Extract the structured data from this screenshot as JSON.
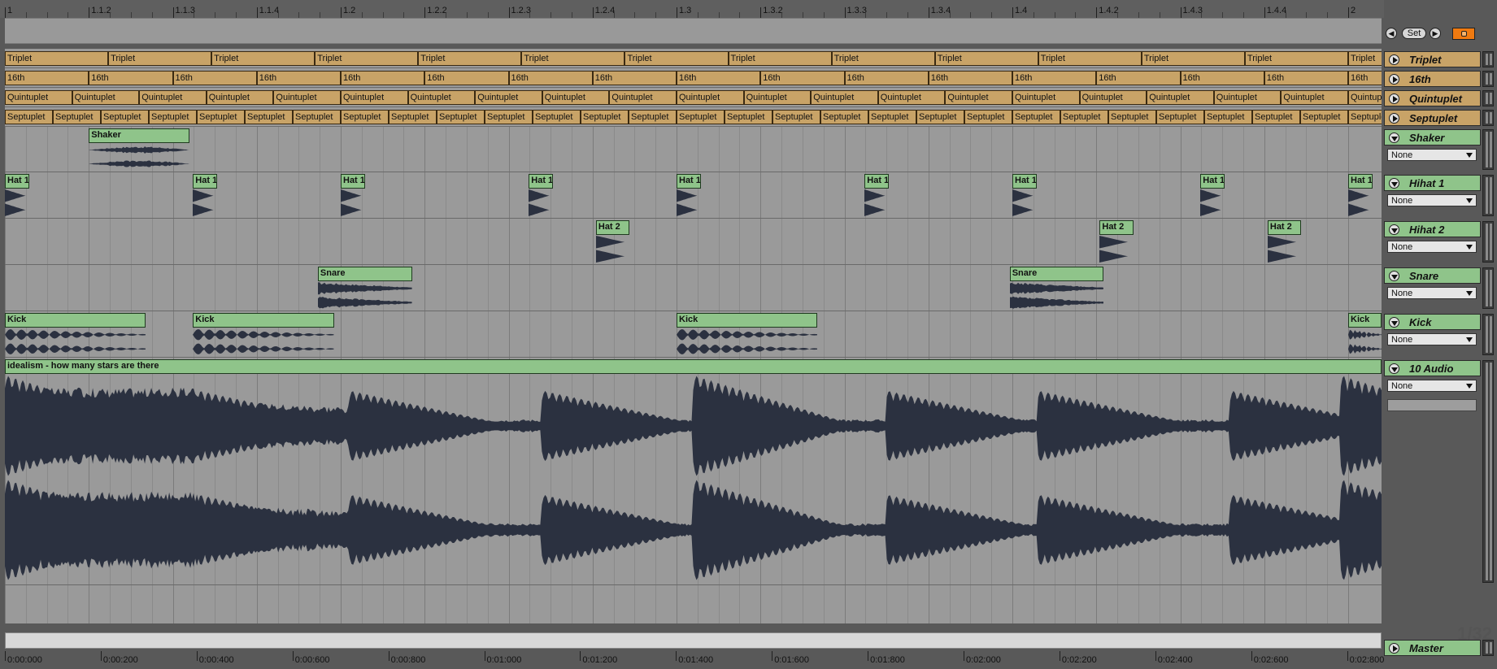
{
  "ruler": {
    "labels": [
      "1",
      "1.1.2",
      "1.1.3",
      "1.1.4",
      "1.2",
      "1.2.2",
      "1.2.3",
      "1.2.4",
      "1.3",
      "1.3.2",
      "1.3.3",
      "1.3.4",
      "1.4",
      "1.4.2",
      "1.4.3",
      "1.4.4",
      "2"
    ]
  },
  "top_controls": {
    "set_label": "Set"
  },
  "locators": {
    "triplet": {
      "name": "Triplet",
      "clip_label": "Triplet",
      "count": 13
    },
    "sixteenth": {
      "name": "16th",
      "clip_label": "16th",
      "count": 16
    },
    "quintuplet": {
      "name": "Quintuplet",
      "clip_label": "Quintuplet",
      "count": 20
    },
    "septuplet": {
      "name": "Septuplet",
      "clip_label": "Septuplet",
      "count": 28
    }
  },
  "tracks": [
    {
      "id": "shaker",
      "name": "Shaker",
      "input": "None",
      "clips": [
        {
          "label": "Shaker",
          "start": 0.0625,
          "length": 0.075
        }
      ]
    },
    {
      "id": "hihat1",
      "name": "Hihat 1",
      "input": "None",
      "clips": [
        {
          "label": "Hat 1",
          "start": 0.0,
          "length": 0.018
        },
        {
          "label": "Hat 1",
          "start": 0.14,
          "length": 0.018
        },
        {
          "label": "Hat 1",
          "start": 0.25,
          "length": 0.018
        },
        {
          "label": "Hat 1",
          "start": 0.39,
          "length": 0.018
        },
        {
          "label": "Hat 1",
          "start": 0.5,
          "length": 0.018
        },
        {
          "label": "Hat 1",
          "start": 0.64,
          "length": 0.018
        },
        {
          "label": "Hat 1",
          "start": 0.75,
          "length": 0.018
        },
        {
          "label": "Hat 1",
          "start": 0.89,
          "length": 0.018
        },
        {
          "label": "Hat 1",
          "start": 1.0,
          "length": 0.018
        }
      ]
    },
    {
      "id": "hihat2",
      "name": "Hihat 2",
      "input": "None",
      "clips": [
        {
          "label": "Hat 2",
          "start": 0.44,
          "length": 0.025
        },
        {
          "label": "Hat 2",
          "start": 0.815,
          "length": 0.025
        },
        {
          "label": "Hat 2",
          "start": 0.94,
          "length": 0.025
        }
      ]
    },
    {
      "id": "snare",
      "name": "Snare",
      "input": "None",
      "clips": [
        {
          "label": "Snare",
          "start": 0.233,
          "length": 0.07
        },
        {
          "label": "Snare",
          "start": 0.748,
          "length": 0.07
        }
      ]
    },
    {
      "id": "kick",
      "name": "Kick",
      "input": "None",
      "clips": [
        {
          "label": "Kick",
          "start": 0.0,
          "length": 0.105
        },
        {
          "label": "Kick",
          "start": 0.14,
          "length": 0.105
        },
        {
          "label": "Kick",
          "start": 0.5,
          "length": 0.105
        },
        {
          "label": "Kick",
          "start": 1.0,
          "length": 0.03
        }
      ]
    },
    {
      "id": "audio10",
      "name": "10 Audio",
      "input": "None",
      "clips": [
        {
          "label": "idealism - how many stars are there",
          "start": 0.0,
          "length": 1.03
        }
      ]
    }
  ],
  "master": {
    "name": "Master"
  },
  "quantization": "1/32",
  "time_ruler": {
    "labels": [
      "0:00:000",
      "0:00:200",
      "0:00:400",
      "0:00:600",
      "0:00:800",
      "0:01:000",
      "0:01:200",
      "0:01:400",
      "0:01:600",
      "0:01:800",
      "0:02:000",
      "0:02:200",
      "0:02:400",
      "0:02:600",
      "0:02:800"
    ]
  },
  "colors": {
    "locator": "#c8a367",
    "audio_clip": "#8fc48a",
    "lane_bg": "#9a9a9a",
    "waveform": "#2b3140",
    "lock": "#f07a10"
  }
}
